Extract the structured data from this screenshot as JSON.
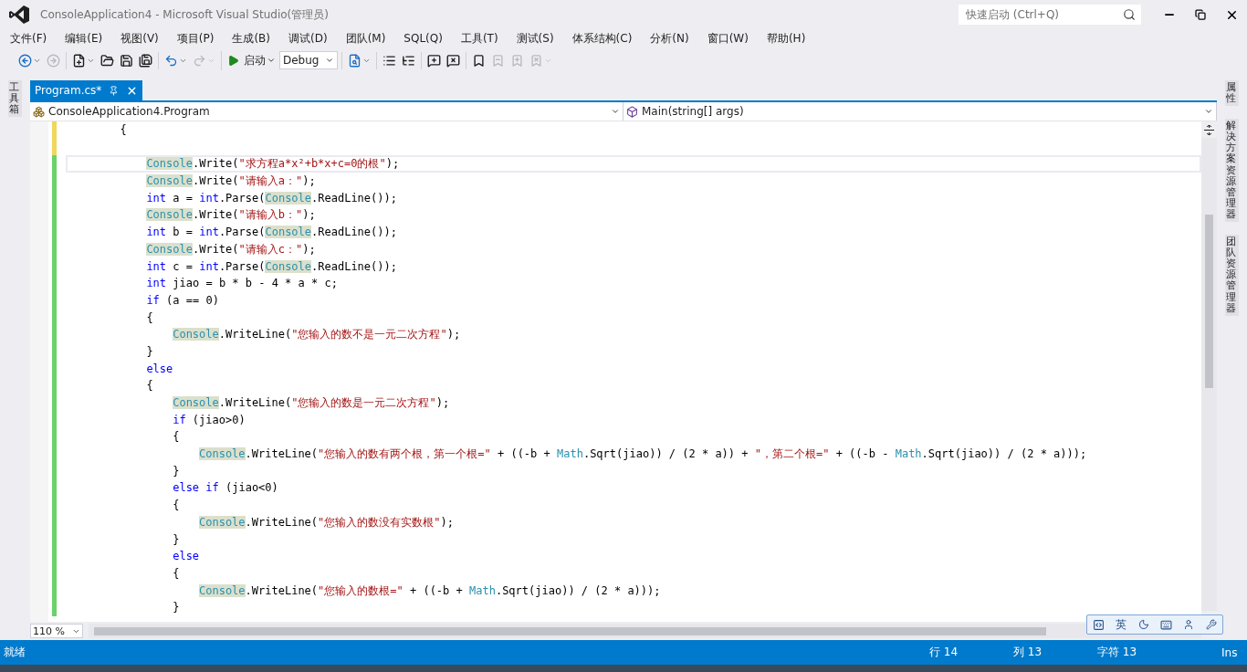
{
  "window": {
    "title": "ConsoleApplication4 - Microsoft Visual Studio(管理员)",
    "quick_launch": {
      "placeholder": "快速启动 (Ctrl+Q)"
    }
  },
  "menu": [
    "文件(F)",
    "编辑(E)",
    "视图(V)",
    "项目(P)",
    "生成(B)",
    "调试(D)",
    "团队(M)",
    "SQL(Q)",
    "工具(T)",
    "测试(S)",
    "体系结构(C)",
    "分析(N)",
    "窗口(W)",
    "帮助(H)"
  ],
  "toolbar": {
    "groups": [
      [
        {
          "kind": "back",
          "disabled": false,
          "dropdown": true
        },
        {
          "kind": "forward",
          "disabled": true,
          "dropdown": false
        }
      ],
      [
        {
          "kind": "new_project",
          "disabled": false,
          "dropdown": true
        },
        {
          "kind": "open",
          "disabled": false,
          "dropdown": false
        },
        {
          "kind": "save",
          "disabled": false,
          "dropdown": false
        },
        {
          "kind": "save_all",
          "disabled": false,
          "dropdown": false
        }
      ],
      [
        {
          "kind": "undo",
          "disabled": false,
          "dropdown": true
        },
        {
          "kind": "redo",
          "disabled": true,
          "dropdown": true
        }
      ],
      [
        {
          "kind": "start",
          "label": "启动",
          "disabled": false,
          "dropdown": true
        },
        {
          "kind": "config",
          "value": "Debug"
        }
      ],
      [
        {
          "kind": "find",
          "disabled": false,
          "dropdown": true
        }
      ],
      [
        {
          "kind": "outdent",
          "disabled": false,
          "dropdown": false
        },
        {
          "kind": "indent",
          "disabled": false,
          "dropdown": false
        }
      ],
      [
        {
          "kind": "comment",
          "disabled": false,
          "dropdown": false
        },
        {
          "kind": "uncomment",
          "disabled": false,
          "dropdown": false
        }
      ],
      [
        {
          "kind": "bookmark",
          "disabled": false,
          "dropdown": false
        },
        {
          "kind": "bookmark_prev",
          "disabled": true,
          "dropdown": false
        },
        {
          "kind": "bookmark_next",
          "disabled": true,
          "dropdown": false
        },
        {
          "kind": "bookmark_clear",
          "disabled": true,
          "dropdown": true
        }
      ]
    ]
  },
  "left_panel_tabs": [
    "工具箱"
  ],
  "right_panel_tabs": [
    "属性",
    "解决方案资源管理器",
    "团队资源管理器"
  ],
  "document_tabs": [
    {
      "label": "Program.cs*",
      "selected": true
    }
  ],
  "navigation": {
    "type": "ConsoleApplication4.Program",
    "member": "Main(string[] args)"
  },
  "code": {
    "lines": [
      {
        "saved": false,
        "current": false,
        "tokens": [
          {
            "kind": "plain",
            "text": "{"
          }
        ],
        "children": [
          {
            "saved": false,
            "current": false
          },
          {
            "saved": true,
            "current": true,
            "tokens": [
              {
                "kind": "ref",
                "text": "Console"
              },
              {
                "kind": "plain",
                "text": ".Write("
              },
              {
                "kind": "string",
                "text": "\"求方程a*x²+b*x+c=0的根\""
              },
              {
                "kind": "plain",
                "text": ");"
              }
            ]
          },
          {
            "saved": true,
            "current": false,
            "tokens": [
              {
                "kind": "ref",
                "text": "Console"
              },
              {
                "kind": "plain",
                "text": ".Write("
              },
              {
                "kind": "string",
                "text": "\"请输入a：\""
              },
              {
                "kind": "plain",
                "text": ");"
              }
            ]
          },
          {
            "saved": true,
            "current": false,
            "tokens": [
              {
                "kind": "keyword",
                "text": "int"
              },
              {
                "kind": "plain",
                "text": " a = "
              },
              {
                "kind": "keyword",
                "text": "int"
              },
              {
                "kind": "plain",
                "text": ".Parse("
              },
              {
                "kind": "ref",
                "text": "Console"
              },
              {
                "kind": "plain",
                "text": ".ReadLine());"
              }
            ]
          },
          {
            "saved": true,
            "current": false,
            "tokens": [
              {
                "kind": "ref",
                "text": "Console"
              },
              {
                "kind": "plain",
                "text": ".Write("
              },
              {
                "kind": "string",
                "text": "\"请输入b：\""
              },
              {
                "kind": "plain",
                "text": ");"
              }
            ]
          },
          {
            "saved": true,
            "current": false,
            "tokens": [
              {
                "kind": "keyword",
                "text": "int"
              },
              {
                "kind": "plain",
                "text": " b = "
              },
              {
                "kind": "keyword",
                "text": "int"
              },
              {
                "kind": "plain",
                "text": ".Parse("
              },
              {
                "kind": "ref",
                "text": "Console"
              },
              {
                "kind": "plain",
                "text": ".ReadLine());"
              }
            ]
          },
          {
            "saved": true,
            "current": false,
            "tokens": [
              {
                "kind": "ref",
                "text": "Console"
              },
              {
                "kind": "plain",
                "text": ".Write("
              },
              {
                "kind": "string",
                "text": "\"请输入c：\""
              },
              {
                "kind": "plain",
                "text": ");"
              }
            ]
          },
          {
            "saved": true,
            "current": false,
            "tokens": [
              {
                "kind": "keyword",
                "text": "int"
              },
              {
                "kind": "plain",
                "text": " c = "
              },
              {
                "kind": "keyword",
                "text": "int"
              },
              {
                "kind": "plain",
                "text": ".Parse("
              },
              {
                "kind": "ref",
                "text": "Console"
              },
              {
                "kind": "plain",
                "text": ".ReadLine());"
              }
            ]
          },
          {
            "saved": true,
            "current": false,
            "tokens": [
              {
                "kind": "keyword",
                "text": "int"
              },
              {
                "kind": "plain",
                "text": " jiao = b * b - 4 * a * c;"
              }
            ]
          },
          {
            "saved": true,
            "current": false,
            "tokens": [
              {
                "kind": "keyword",
                "text": "if"
              },
              {
                "kind": "plain",
                "text": " (a == 0)"
              }
            ]
          },
          {
            "saved": true,
            "current": false,
            "tokens": [
              {
                "kind": "plain",
                "text": "{"
              }
            ],
            "children": [
              {
                "saved": true,
                "current": false,
                "tokens": [
                  {
                    "kind": "ref",
                    "text": "Console"
                  },
                  {
                    "kind": "plain",
                    "text": ".WriteLine("
                  },
                  {
                    "kind": "string",
                    "text": "\"您输入的数不是一元二次方程\""
                  },
                  {
                    "kind": "plain",
                    "text": ");"
                  }
                ]
              }
            ]
          },
          {
            "saved": true,
            "current": false,
            "tokens": [
              {
                "kind": "plain",
                "text": "}"
              }
            ]
          },
          {
            "saved": true,
            "current": false,
            "tokens": [
              {
                "kind": "keyword",
                "text": "else"
              }
            ]
          },
          {
            "saved": true,
            "current": false,
            "tokens": [
              {
                "kind": "plain",
                "text": "{"
              }
            ],
            "children": [
              {
                "saved": true,
                "current": false,
                "tokens": [
                  {
                    "kind": "ref",
                    "text": "Console"
                  },
                  {
                    "kind": "plain",
                    "text": ".WriteLine("
                  },
                  {
                    "kind": "string",
                    "text": "\"您输入的数是一元二次方程\""
                  },
                  {
                    "kind": "plain",
                    "text": ");"
                  }
                ]
              },
              {
                "saved": true,
                "current": false,
                "tokens": [
                  {
                    "kind": "keyword",
                    "text": "if"
                  },
                  {
                    "kind": "plain",
                    "text": " (jiao>0)"
                  }
                ]
              },
              {
                "saved": true,
                "current": false,
                "tokens": [
                  {
                    "kind": "plain",
                    "text": "{"
                  }
                ],
                "children": [
                  {
                    "saved": true,
                    "current": false,
                    "tokens": [
                      {
                        "kind": "ref",
                        "text": "Console"
                      },
                      {
                        "kind": "plain",
                        "text": ".WriteLine("
                      },
                      {
                        "kind": "string",
                        "text": "\"您输入的数有两个根，第一个根=\""
                      },
                      {
                        "kind": "plain",
                        "text": " + ((-b + "
                      },
                      {
                        "kind": "type",
                        "text": "Math"
                      },
                      {
                        "kind": "plain",
                        "text": ".Sqrt(jiao)) / (2 * a)) + "
                      },
                      {
                        "kind": "string",
                        "text": "\"，第二个根=\""
                      },
                      {
                        "kind": "plain",
                        "text": " + ((-b - "
                      },
                      {
                        "kind": "type",
                        "text": "Math"
                      },
                      {
                        "kind": "plain",
                        "text": ".Sqrt(jiao)) / (2 * a)));"
                      }
                    ]
                  }
                ]
              },
              {
                "saved": true,
                "current": false,
                "tokens": [
                  {
                    "kind": "plain",
                    "text": "}"
                  }
                ]
              },
              {
                "saved": true,
                "current": false,
                "tokens": [
                  {
                    "kind": "keyword",
                    "text": "else if"
                  },
                  {
                    "kind": "plain",
                    "text": " (jiao<0)"
                  }
                ]
              },
              {
                "saved": true,
                "current": false,
                "tokens": [
                  {
                    "kind": "plain",
                    "text": "{"
                  }
                ],
                "children": [
                  {
                    "saved": true,
                    "current": false,
                    "tokens": [
                      {
                        "kind": "ref",
                        "text": "Console"
                      },
                      {
                        "kind": "plain",
                        "text": ".WriteLine("
                      },
                      {
                        "kind": "string",
                        "text": "\"您输入的数没有实数根\""
                      },
                      {
                        "kind": "plain",
                        "text": ");"
                      }
                    ]
                  }
                ]
              },
              {
                "saved": true,
                "current": false,
                "tokens": [
                  {
                    "kind": "plain",
                    "text": "}"
                  }
                ]
              },
              {
                "saved": true,
                "current": false,
                "tokens": [
                  {
                    "kind": "keyword",
                    "text": "else"
                  }
                ]
              },
              {
                "saved": true,
                "current": false,
                "tokens": [
                  {
                    "kind": "plain",
                    "text": "{"
                  }
                ],
                "children": [
                  {
                    "saved": true,
                    "current": false,
                    "tokens": [
                      {
                        "kind": "ref",
                        "text": "Console"
                      },
                      {
                        "kind": "plain",
                        "text": ".WriteLine("
                      },
                      {
                        "kind": "string",
                        "text": "\"您输入的数根=\""
                      },
                      {
                        "kind": "plain",
                        "text": " + ((-b + "
                      },
                      {
                        "kind": "type",
                        "text": "Math"
                      },
                      {
                        "kind": "plain",
                        "text": ".Sqrt(jiao)) / (2 * a)));"
                      }
                    ]
                  }
                ]
              },
              {
                "saved": true,
                "current": false,
                "tokens": [
                  {
                    "kind": "plain",
                    "text": "}"
                  }
                ]
              }
            ]
          }
        ]
      }
    ]
  },
  "zoom": {
    "value": "110 %"
  },
  "ime_bar": {
    "mode": "英"
  },
  "status_bar": {
    "message": "就绪",
    "line": "行 14",
    "column": "列 13",
    "char": "字符 13",
    "mode": "Ins"
  }
}
